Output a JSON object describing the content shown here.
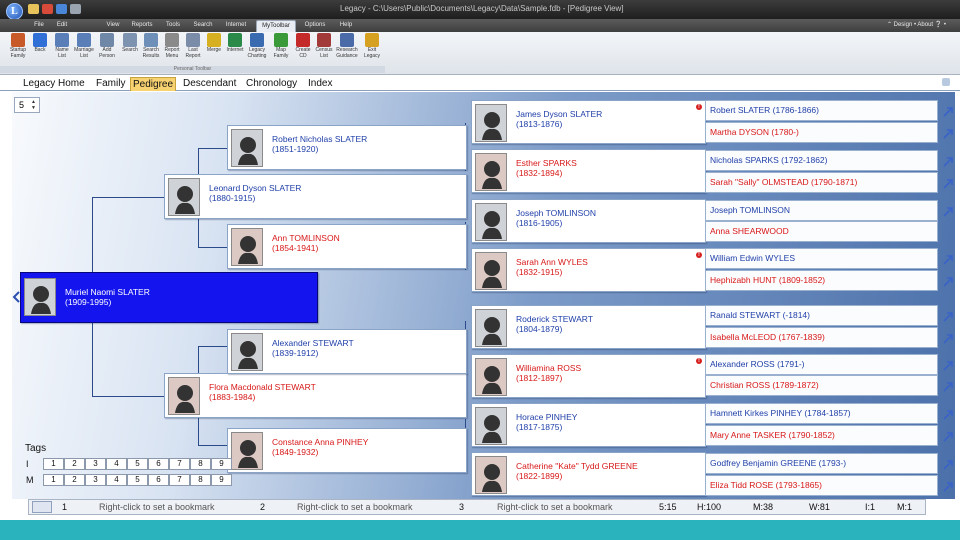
{
  "window": {
    "title": "Legacy - C:\\Users\\Public\\Documents\\Legacy\\Data\\Sample.fdb - [Pedigree View]"
  },
  "menu": {
    "tabs": [
      "File",
      "Edit",
      "View",
      "Reports",
      "Tools",
      "Search",
      "Internet",
      "MyToolbar",
      "Options",
      "Help"
    ],
    "active": "MyToolbar",
    "right": "⌃ Design • About ❔ •"
  },
  "ribbon": {
    "buttons": [
      {
        "label": "Startup\nFamily",
        "icon": "home-icon",
        "color": "#c85a2a"
      },
      {
        "label": "Back",
        "icon": "back-arrow-icon",
        "color": "#2f6fd6"
      },
      {
        "label": "Name\nList",
        "icon": "name-list-icon",
        "color": "#5a7fb8"
      },
      {
        "label": "Marriage\nList",
        "icon": "marriage-list-icon",
        "color": "#5a7fb8"
      },
      {
        "label": "Add\nPerson",
        "icon": "add-person-icon",
        "color": "#6f88a8"
      },
      {
        "label": "Search",
        "icon": "search-icon",
        "color": "#7e93b0"
      },
      {
        "label": "Search\nResults",
        "icon": "search-results-icon",
        "color": "#6e8fb8"
      },
      {
        "label": "Report\nMenu",
        "icon": "report-menu-icon",
        "color": "#8a8a8a"
      },
      {
        "label": "Last\nReport",
        "icon": "last-report-icon",
        "color": "#7a8ca8"
      },
      {
        "label": "Merge",
        "icon": "merge-icon",
        "color": "#d6b020"
      },
      {
        "label": "Internet",
        "icon": "internet-icon",
        "color": "#2a8a4a"
      },
      {
        "label": "Legacy\nCharting",
        "icon": "charting-icon",
        "color": "#3a6ab0"
      },
      {
        "label": "Map\nFamily",
        "icon": "map-icon",
        "color": "#3a9a3a"
      },
      {
        "label": "Create\nCD",
        "icon": "cd-icon",
        "color": "#c42a2a"
      },
      {
        "label": "Census\nList",
        "icon": "census-icon",
        "color": "#a33a3a"
      },
      {
        "label": "Research\nGuidance",
        "icon": "research-icon",
        "color": "#4a6aa8"
      },
      {
        "label": "Exit\nLegacy",
        "icon": "exit-icon",
        "color": "#d6a020"
      }
    ],
    "group_label": "Personal Toolbar"
  },
  "view_tabs": [
    "Legacy Home",
    "Family",
    "Pedigree",
    "Descendant",
    "Chronology",
    "Index"
  ],
  "active_view": "Pedigree",
  "generations": "5",
  "pedigree": {
    "root": {
      "name": "Muriel Naomi SLATER",
      "dates": "(1909-1995)"
    },
    "father": {
      "name": "Leonard Dyson SLATER",
      "dates": "(1880-1915)"
    },
    "mother": {
      "name": "Flora Macdonald STEWART",
      "dates": "(1883-1984)"
    },
    "pgf": {
      "name": "Robert Nicholas SLATER",
      "dates": "(1851-1920)"
    },
    "pgm": {
      "name": "Ann TOMLINSON",
      "dates": "(1854-1941)"
    },
    "mgf": {
      "name": "Alexander STEWART",
      "dates": "(1839-1912)"
    },
    "mgm": {
      "name": "Constance Anna PINHEY",
      "dates": "(1849-1932)"
    },
    "g3": [
      {
        "name": "James Dyson SLATER",
        "dates": "(1813-1876)",
        "sex": "m"
      },
      {
        "name": "Esther SPARKS",
        "dates": "(1832-1894)",
        "sex": "f"
      },
      {
        "name": "Joseph TOMLINSON",
        "dates": "(1816-1905)",
        "sex": "m"
      },
      {
        "name": "Sarah Ann WYLES",
        "dates": "(1832-1915)",
        "sex": "f"
      },
      {
        "name": "Roderick STEWART",
        "dates": "(1804-1879)",
        "sex": "m"
      },
      {
        "name": "Williamina ROSS",
        "dates": "(1812-1897)",
        "sex": "f"
      },
      {
        "name": "Horace PINHEY",
        "dates": "(1817-1875)",
        "sex": "m"
      },
      {
        "name": "Catherine \"Kate\" Tydd GREENE",
        "dates": "(1822-1899)",
        "sex": "f"
      }
    ],
    "g4": [
      {
        "text": "Robert SLATER (1786-1866)",
        "sex": "m"
      },
      {
        "text": "Martha DYSON (1780-)",
        "sex": "f"
      },
      {
        "text": "Nicholas SPARKS (1792-1862)",
        "sex": "m"
      },
      {
        "text": "Sarah \"Sally\" OLMSTEAD (1790-1871)",
        "sex": "f"
      },
      {
        "text": "Joseph TOMLINSON",
        "sex": "m"
      },
      {
        "text": "Anna SHEARWOOD",
        "sex": "f"
      },
      {
        "text": "William Edwin WYLES",
        "sex": "m"
      },
      {
        "text": "Hephizabh HUNT (1809-1852)",
        "sex": "f"
      },
      {
        "text": "Ranald STEWART (-1814)",
        "sex": "m"
      },
      {
        "text": "Isabella McLEOD (1767-1839)",
        "sex": "f"
      },
      {
        "text": "Alexander ROSS (1791-)",
        "sex": "m"
      },
      {
        "text": "Christian ROSS (1789-1872)",
        "sex": "f"
      },
      {
        "text": "Hamnett Kirkes PINHEY (1784-1857)",
        "sex": "m"
      },
      {
        "text": "Mary Anne TASKER (1790-1852)",
        "sex": "f"
      },
      {
        "text": "Godfrey Benjamin GREENE (1793-)",
        "sex": "m"
      },
      {
        "text": "Eliza Tidd ROSE (1793-1865)",
        "sex": "f"
      }
    ]
  },
  "tags": {
    "title": "Tags",
    "rows": [
      {
        "label": "I",
        "boxes": [
          "1",
          "2",
          "3",
          "4",
          "5",
          "6",
          "7",
          "8",
          "9"
        ]
      },
      {
        "label": "M",
        "boxes": [
          "1",
          "2",
          "3",
          "4",
          "5",
          "6",
          "7",
          "8",
          "9"
        ]
      }
    ]
  },
  "status": {
    "bookmarks": [
      {
        "num": "1",
        "text": "Right-click to set a bookmark"
      },
      {
        "num": "2",
        "text": "Right-click to set a bookmark"
      },
      {
        "num": "3",
        "text": "Right-click to set a bookmark"
      }
    ],
    "fields": [
      "5:15",
      "H:100",
      "M:38",
      "W:81",
      "I:1",
      "M:1"
    ]
  },
  "colors": {
    "male_text": "#1f3fa8",
    "female_text": "#d81818",
    "selected_card": "#1414ee",
    "active_tab": "#f7d271",
    "bottom_band": "#2ab3bd"
  }
}
